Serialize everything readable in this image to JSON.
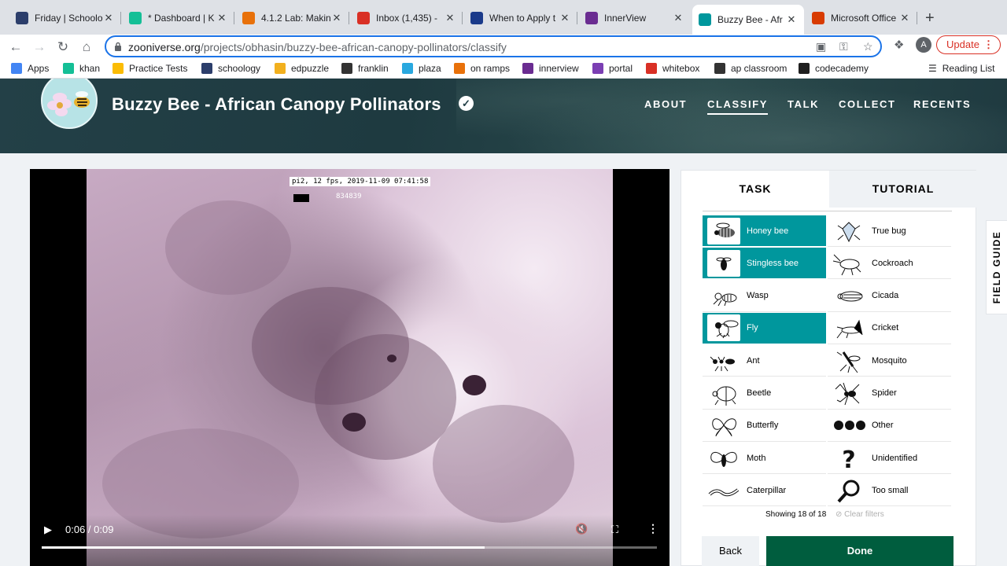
{
  "browser": {
    "tabs": [
      {
        "title": "Friday | Schoolo",
        "icon": "schoology-icon",
        "color": "#2c3e6b"
      },
      {
        "title": "* Dashboard | K",
        "icon": "khan-icon",
        "color": "#14bf96"
      },
      {
        "title": "4.1.2 Lab: Makin",
        "icon": "lab-icon",
        "color": "#e8710a"
      },
      {
        "title": "Inbox (1,435) -",
        "icon": "gmail-icon",
        "color": "#d93025"
      },
      {
        "title": "When to Apply t",
        "icon": "usnews-icon",
        "color": "#1a3a8a"
      },
      {
        "title": "InnerView",
        "icon": "innerview-icon",
        "color": "#6a2c91"
      },
      {
        "title": "Buzzy Bee - Afr",
        "icon": "zooniverse-icon",
        "color": "#00979d"
      },
      {
        "title": "Microsoft Office",
        "icon": "office-icon",
        "color": "#d83b01"
      }
    ],
    "url_host": "zooniverse.org",
    "url_path": "/projects/obhasin/buzzy-bee-african-canopy-pollinators/classify",
    "avatar_letter": "A",
    "update_label": "Update",
    "bookmarks": [
      {
        "label": "Apps",
        "icon": "apps-grid-icon",
        "color": "#4285f4"
      },
      {
        "label": "khan",
        "icon": "khan-icon",
        "color": "#14bf96"
      },
      {
        "label": "Practice Tests",
        "icon": "drive-icon",
        "color": "#fbbc04"
      },
      {
        "label": "schoology",
        "icon": "schoology-icon",
        "color": "#2c3e6b"
      },
      {
        "label": "edpuzzle",
        "icon": "edpuzzle-icon",
        "color": "#f2b01e"
      },
      {
        "label": "franklin",
        "icon": "franklin-icon",
        "color": "#333333"
      },
      {
        "label": "plaza",
        "icon": "plaza-icon",
        "color": "#29a8df"
      },
      {
        "label": "on ramps",
        "icon": "onramps-icon",
        "color": "#e8710a"
      },
      {
        "label": "innerview",
        "icon": "innerview-icon",
        "color": "#6a2c91"
      },
      {
        "label": "portal",
        "icon": "portal-icon",
        "color": "#7b3fb3"
      },
      {
        "label": "whitebox",
        "icon": "whitebox-icon",
        "color": "#d93025"
      },
      {
        "label": "ap classroom",
        "icon": "apclassroom-icon",
        "color": "#333333"
      },
      {
        "label": "codecademy",
        "icon": "codecademy-icon",
        "color": "#1f1f1f"
      }
    ],
    "reading_list": "Reading List"
  },
  "project": {
    "title": "Buzzy Bee - African Canopy Pollinators",
    "nav": [
      "ABOUT",
      "CLASSIFY",
      "TALK",
      "COLLECT",
      "RECENTS"
    ],
    "active_nav": "CLASSIFY"
  },
  "video": {
    "overlay_stamp": "pi2, 12 fps, 2019-11-09 07:41:58",
    "frame_number": "834839",
    "time": "0:06 / 0:09",
    "progress": 0.72
  },
  "panel": {
    "tabs": [
      "TASK",
      "TUTORIAL"
    ],
    "choices": [
      {
        "label": "Honey bee",
        "icon": "honey-bee-icon",
        "selected": true
      },
      {
        "label": "True bug",
        "icon": "true-bug-icon",
        "selected": false
      },
      {
        "label": "Stingless bee",
        "icon": "stingless-bee-icon",
        "selected": true
      },
      {
        "label": "Cockroach",
        "icon": "cockroach-icon",
        "selected": false
      },
      {
        "label": "Wasp",
        "icon": "wasp-icon",
        "selected": false
      },
      {
        "label": "Cicada",
        "icon": "cicada-icon",
        "selected": false
      },
      {
        "label": "Fly",
        "icon": "fly-icon",
        "selected": true
      },
      {
        "label": "Cricket",
        "icon": "cricket-icon",
        "selected": false
      },
      {
        "label": "Ant",
        "icon": "ant-icon",
        "selected": false
      },
      {
        "label": "Mosquito",
        "icon": "mosquito-icon",
        "selected": false
      },
      {
        "label": "Beetle",
        "icon": "beetle-icon",
        "selected": false
      },
      {
        "label": "Spider",
        "icon": "spider-icon",
        "selected": false
      },
      {
        "label": "Butterfly",
        "icon": "butterfly-icon",
        "selected": false
      },
      {
        "label": "Other",
        "icon": "three-dots-icon",
        "selected": false
      },
      {
        "label": "Moth",
        "icon": "moth-icon",
        "selected": false
      },
      {
        "label": "Unidentified",
        "icon": "question-mark-icon",
        "selected": false
      },
      {
        "label": "Caterpillar",
        "icon": "caterpillar-icon",
        "selected": false
      },
      {
        "label": "Too small",
        "icon": "magnifier-icon",
        "selected": false
      }
    ],
    "showing": "Showing 18 of 18",
    "clear_filters": "Clear filters",
    "back_label": "Back",
    "done_label": "Done",
    "field_guide": "FIELD GUIDE"
  },
  "colors": {
    "selected_choice": "#00979d",
    "done_button": "#005d3e",
    "header_bg": "#234047"
  }
}
